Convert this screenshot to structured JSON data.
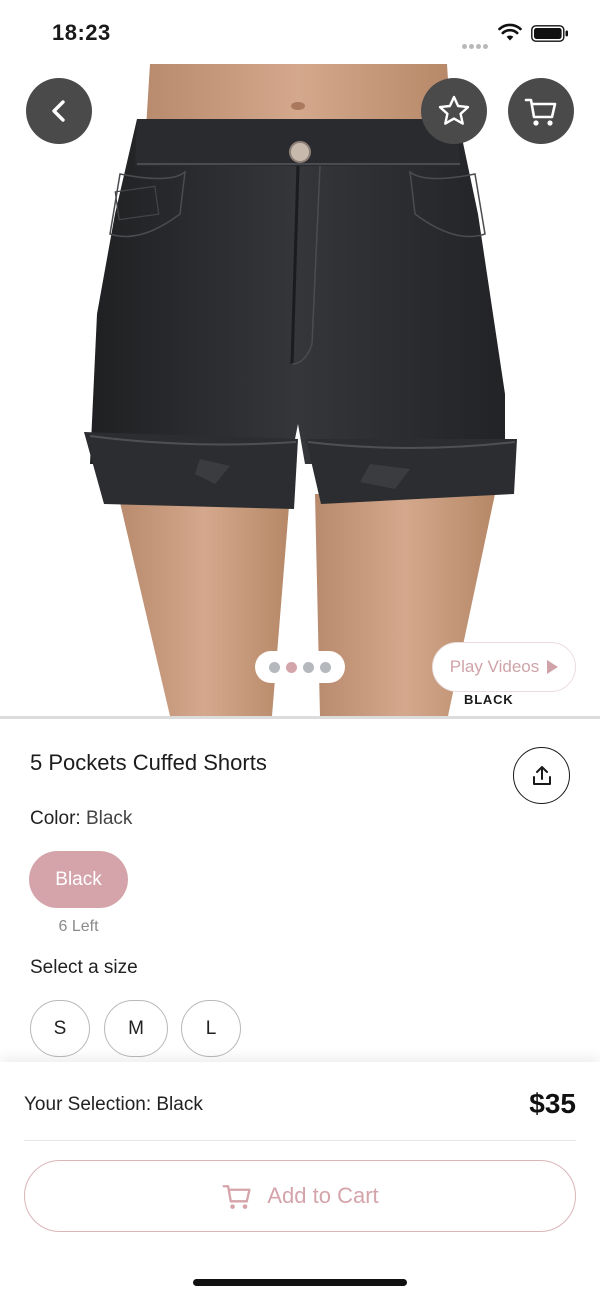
{
  "status_bar": {
    "time": "18:23"
  },
  "hero": {
    "pager": {
      "count": 4,
      "active_index": 1
    },
    "play_videos_label": "Play Videos",
    "color_caption": "BLACK"
  },
  "product": {
    "title": "5 Pockets Cuffed Shorts",
    "color_label": "Color:",
    "color_value": "Black",
    "swatches": [
      {
        "label": "Black",
        "stock": "6 Left",
        "selected": true
      }
    ],
    "size_label": "Select a size",
    "sizes": [
      "S",
      "M",
      "L"
    ]
  },
  "footer": {
    "selection_text": "Your Selection: Black",
    "price": "$35",
    "add_to_cart_label": "Add to Cart"
  },
  "colors": {
    "accent_pink": "#d4a4aa",
    "button_dark": "#4a4a4a",
    "denim": "#2f3033",
    "skin": "#c99a7d"
  },
  "icons": {
    "back": "chevron-left-icon",
    "favorite": "star-icon",
    "cart": "cart-icon",
    "share": "share-icon",
    "play": "play-icon"
  }
}
